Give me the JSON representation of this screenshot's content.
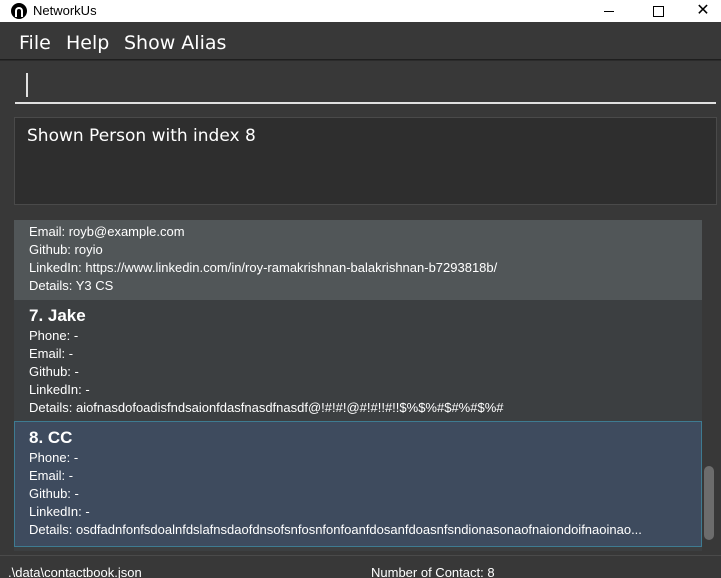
{
  "window": {
    "title": "NetworkUs",
    "minimize_icon": "minimize-icon",
    "maximize_icon": "maximize-icon",
    "close_icon": "close-icon",
    "close_glyph": "✕"
  },
  "menu": {
    "file": "File",
    "help": "Help",
    "alias": "Show Alias"
  },
  "command": {
    "value": ""
  },
  "result": {
    "text": "Shown Person with index 8"
  },
  "persons": [
    {
      "email": "Email: royb@example.com",
      "github": "Github: royio",
      "linkedin": "LinkedIn: https://www.linkedin.com/in/roy-ramakrishnan-balakrishnan-b7293818b/",
      "details": "Details: Y3 CS"
    },
    {
      "name": "7.  Jake",
      "phone": "Phone: -",
      "email": "Email: -",
      "github": "Github: -",
      "linkedin": "LinkedIn: -",
      "details": "Details: aiofnasdofoadisfndsaionfdasfnasdfnasdf@!#!#!@#!#!!#!!$%$%#$#%#$%#"
    },
    {
      "name": "8.  CC",
      "phone": "Phone: -",
      "email": "Email: -",
      "github": "Github: -",
      "linkedin": "LinkedIn: -",
      "details": "Details: osdfadnfonfsdoalnfdslafnsdaofdnsofsnfosnfonfoanfdosanfdoasnfsndionasonaofnaiondoifnaoinao..."
    }
  ],
  "status": {
    "path": ".\\data\\contactbook.json",
    "count": "Number of Contact: 8"
  }
}
